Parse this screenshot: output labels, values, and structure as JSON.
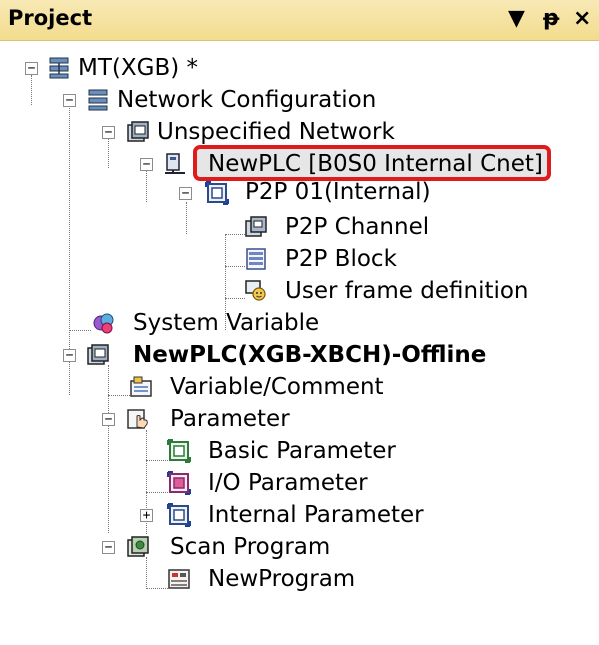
{
  "panel": {
    "title": "Project",
    "dropdown_glyph": "▼",
    "pin_glyph": "ᵽ",
    "close_glyph": "×"
  },
  "tree": {
    "root": "MT(XGB) *",
    "network_config": "Network Configuration",
    "unspecified_network": "Unspecified Network",
    "plc_node": "NewPLC [B0S0 Internal Cnet]",
    "p2p_node": "P2P 01(Internal)",
    "p2p_channel": "P2P Channel",
    "p2p_block": "P2P Block",
    "user_frame": "User frame definition",
    "system_variable": "System Variable",
    "plc_offline": "NewPLC(XGB-XBCH)-Offline",
    "variable_comment": "Variable/Comment",
    "parameter": "Parameter",
    "basic_parameter": "Basic Parameter",
    "io_parameter": "I/O Parameter",
    "internal_parameter": "Internal Parameter",
    "scan_program": "Scan Program",
    "new_program": "NewProgram"
  },
  "expanders": {
    "expanded": "−",
    "collapsed": "+"
  },
  "colors": {
    "selection_outline": "#e01b1b",
    "titlebar": "#f2dc8e",
    "selection_fill": "#e6e6e6"
  }
}
